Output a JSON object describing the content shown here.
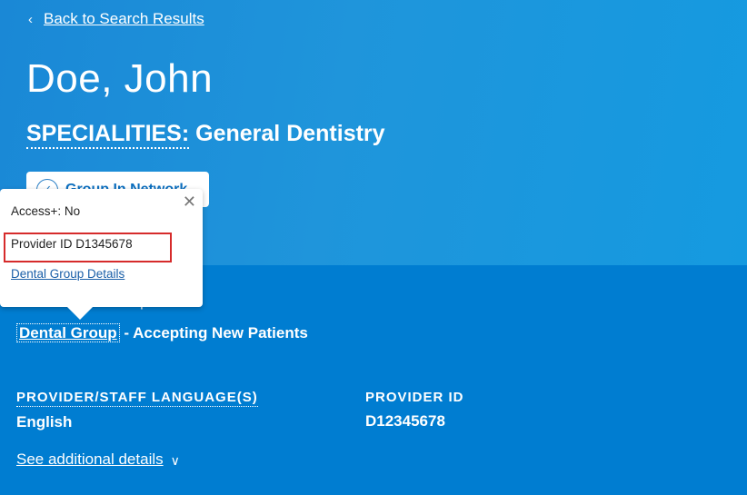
{
  "nav": {
    "back_label": "Back to Search Results"
  },
  "provider": {
    "name": "Doe, John",
    "specialities_label": "SPECIALITIES:",
    "specialities_value": "General Dentistry",
    "network_badge": "Group In Network"
  },
  "popup": {
    "access": "Access+: No",
    "provider_id": "Provider ID D1345678",
    "details_link": "Dental Group Details"
  },
  "group": {
    "partial_text": "p",
    "link": "Dental Group",
    "status": " - Accepting New Patients"
  },
  "info": {
    "language_header": "PROVIDER/STAFF LANGUAGE(S)",
    "language_value": "English",
    "provider_id_header": "PROVIDER ID",
    "provider_id_value": "D12345678"
  },
  "more": {
    "label": "See additional details"
  },
  "icons": {
    "back": "chevron-left-icon",
    "close": "close-icon",
    "check": "check-circle-icon",
    "expand": "chevron-down-icon"
  },
  "colors": {
    "header_bg": "#1f95db",
    "body_bg": "#007dd1",
    "highlight": "#d62b2b",
    "link": "#1a5fa8"
  }
}
